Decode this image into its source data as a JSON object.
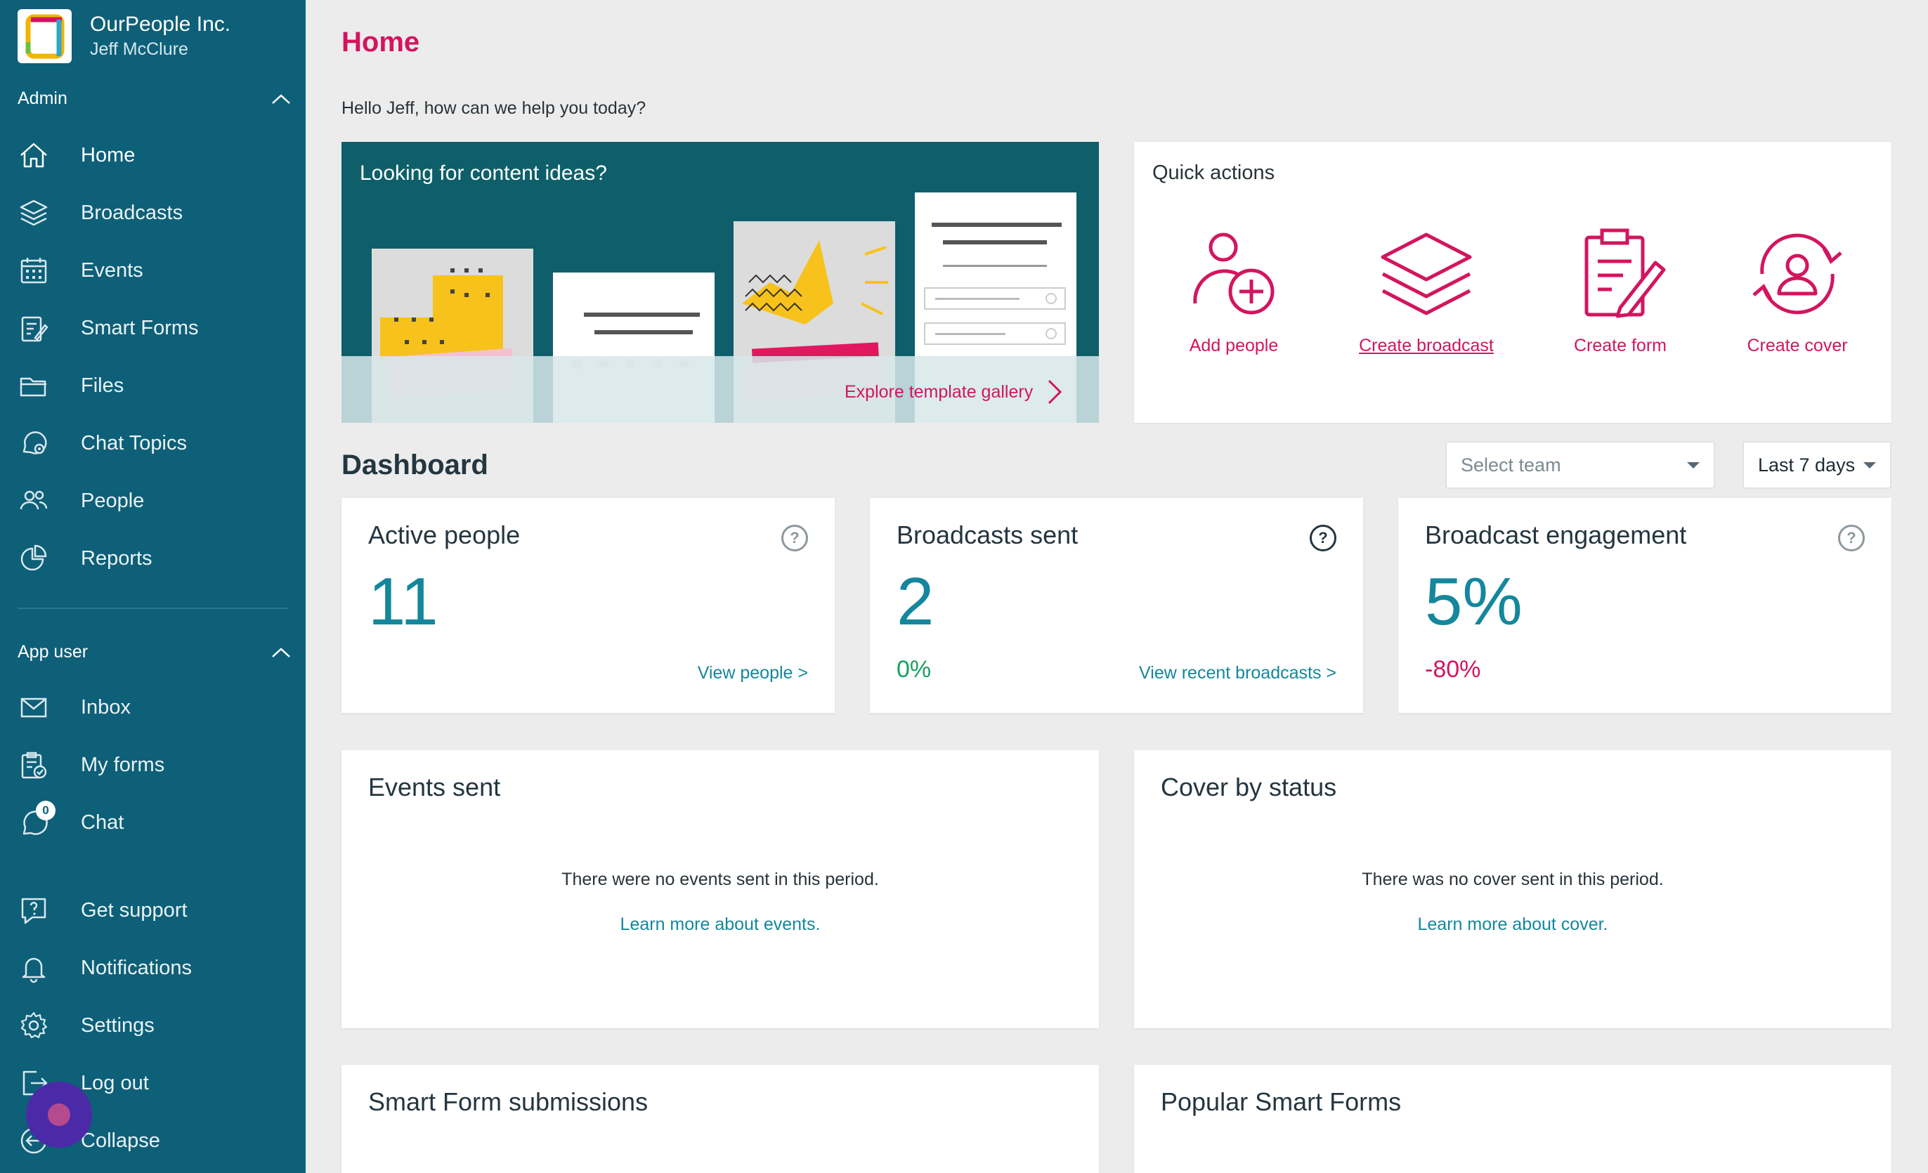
{
  "org": {
    "name": "OurPeople Inc.",
    "user": "Jeff McClure"
  },
  "sidebar": {
    "admin_label": "Admin",
    "admin_items": [
      {
        "label": "Home",
        "icon": "home-icon"
      },
      {
        "label": "Broadcasts",
        "icon": "layers-icon"
      },
      {
        "label": "Events",
        "icon": "calendar-icon"
      },
      {
        "label": "Smart Forms",
        "icon": "form-icon"
      },
      {
        "label": "Files",
        "icon": "folder-icon"
      },
      {
        "label": "Chat Topics",
        "icon": "chat-gear-icon"
      },
      {
        "label": "People",
        "icon": "people-icon"
      },
      {
        "label": "Reports",
        "icon": "pie-chart-icon"
      }
    ],
    "app_user_label": "App user",
    "app_user_items": [
      {
        "label": "Inbox",
        "icon": "mail-icon"
      },
      {
        "label": "My forms",
        "icon": "clipboard-check-icon"
      },
      {
        "label": "Chat",
        "icon": "chat-icon",
        "badge": "0"
      }
    ],
    "bottom_items": [
      {
        "label": "Get support",
        "icon": "help-chat-icon"
      },
      {
        "label": "Notifications",
        "icon": "bell-icon"
      },
      {
        "label": "Settings",
        "icon": "gear-icon"
      },
      {
        "label": "Log out",
        "icon": "logout-icon"
      },
      {
        "label": "Collapse",
        "icon": "collapse-icon"
      }
    ]
  },
  "main": {
    "title": "Home",
    "greeting": "Hello Jeff, how can we help you today?",
    "banner": {
      "title": "Looking for content ideas?",
      "link": "Explore template gallery"
    },
    "quick_actions": {
      "title": "Quick actions",
      "items": [
        {
          "label": "Add people",
          "icon": "add-person-icon"
        },
        {
          "label": "Create broadcast",
          "icon": "layers-icon"
        },
        {
          "label": "Create form",
          "icon": "clipboard-edit-icon"
        },
        {
          "label": "Create cover",
          "icon": "person-refresh-icon"
        }
      ]
    },
    "dashboard": {
      "title": "Dashboard",
      "team_placeholder": "Select team",
      "period": "Last 7 days",
      "stats": [
        {
          "title": "Active people",
          "value": "11",
          "change": "",
          "link": "View people >"
        },
        {
          "title": "Broadcasts sent",
          "value": "2",
          "change": "0%",
          "link": "View recent broadcasts >"
        },
        {
          "title": "Broadcast engagement",
          "value": "5%",
          "change": "-80%",
          "link": ""
        }
      ],
      "events": {
        "title": "Events sent",
        "message": "There were no events sent in this period.",
        "link": "Learn more about events."
      },
      "cover": {
        "title": "Cover by status",
        "message": "There was no cover sent in this period.",
        "link": "Learn more about cover."
      },
      "submissions": {
        "title": "Smart Form submissions"
      },
      "popular": {
        "title": "Popular Smart Forms"
      }
    }
  },
  "colors": {
    "sidebar": "#0e5f78",
    "accent": "#d3155f",
    "teal": "#14879c",
    "positive": "#18a060"
  }
}
